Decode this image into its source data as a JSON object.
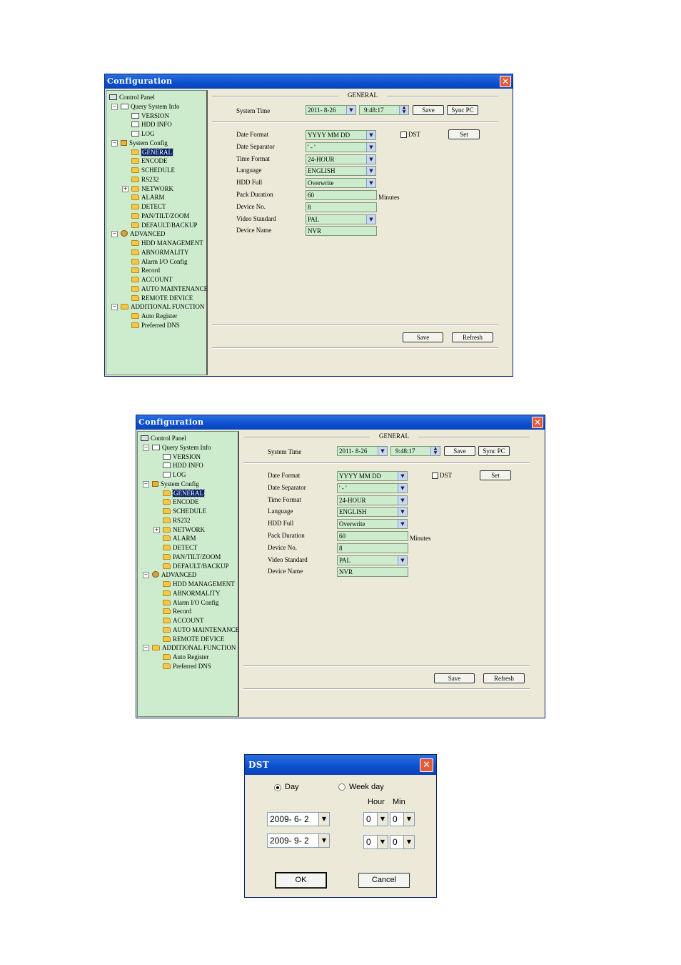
{
  "config": {
    "title": "Configuration",
    "close_glyph": "✕",
    "tree": [
      {
        "label": "Control Panel",
        "icon": "control-panel-icon"
      },
      {
        "label": "Query System Info",
        "icon": "query-info-icon",
        "expander": "−"
      },
      {
        "label": "VERSION",
        "icon": "document-icon"
      },
      {
        "label": "HDD INFO",
        "icon": "document-icon"
      },
      {
        "label": "LOG",
        "icon": "document-icon"
      },
      {
        "label": "System Config",
        "icon": "tools-icon",
        "expander": "−"
      },
      {
        "label": "GENERAL",
        "icon": "folder-open-icon",
        "selected": true
      },
      {
        "label": "ENCODE",
        "icon": "folder-icon"
      },
      {
        "label": "SCHEDULE",
        "icon": "folder-icon"
      },
      {
        "label": "RS232",
        "icon": "folder-icon"
      },
      {
        "label": "NETWORK",
        "icon": "folder-icon",
        "expander": "+"
      },
      {
        "label": "ALARM",
        "icon": "folder-icon"
      },
      {
        "label": "DETECT",
        "icon": "folder-icon"
      },
      {
        "label": "PAN/TILT/ZOOM",
        "icon": "folder-icon"
      },
      {
        "label": "DEFAULT/BACKUP",
        "icon": "folder-icon"
      },
      {
        "label": "ADVANCED",
        "icon": "advanced-icon",
        "expander": "−"
      },
      {
        "label": "HDD MANAGEMENT",
        "icon": "folder-icon"
      },
      {
        "label": "ABNORMALITY",
        "icon": "folder-icon"
      },
      {
        "label": "Alarm I/O Config",
        "icon": "folder-icon"
      },
      {
        "label": "Record",
        "icon": "folder-icon"
      },
      {
        "label": "ACCOUNT",
        "icon": "folder-icon"
      },
      {
        "label": "AUTO MAINTENANCE",
        "icon": "folder-icon"
      },
      {
        "label": "REMOTE DEVICE",
        "icon": "folder-icon"
      },
      {
        "label": "ADDITIONAL FUNCTION",
        "icon": "folder-icon",
        "expander": "−"
      },
      {
        "label": "Auto Register",
        "icon": "folder-icon"
      },
      {
        "label": "Preferred DNS",
        "icon": "folder-icon"
      }
    ],
    "general": {
      "section_title": "GENERAL",
      "system_time_label": "System Time",
      "date_value": "2011- 8-26",
      "time_value": "9:48:17",
      "save_label": "Save",
      "sync_pc_label": "Sync PC",
      "dst_label": "DST",
      "set_label": "Set",
      "minutes_label": "Minutes",
      "fields": [
        {
          "label": "Date Format",
          "value": "YYYY MM DD",
          "dropdown": true
        },
        {
          "label": "Date Separator",
          "value": "' - '",
          "dropdown": true
        },
        {
          "label": "Time Format",
          "value": "24-HOUR",
          "dropdown": true
        },
        {
          "label": "Language",
          "value": "ENGLISH",
          "dropdown": true
        },
        {
          "label": "HDD Full",
          "value": "Overwrite",
          "dropdown": true
        },
        {
          "label": "Pack Duration",
          "value": "60",
          "dropdown": false
        },
        {
          "label": "Device No.",
          "value": "8",
          "dropdown": false
        },
        {
          "label": "Video Standard",
          "value": "PAL",
          "dropdown": true
        },
        {
          "label": "Device Name",
          "value": "NVR",
          "dropdown": false
        }
      ],
      "bottom_save_label": "Save",
      "refresh_label": "Refresh"
    }
  },
  "dst_dialog": {
    "title": "DST",
    "close_glyph": "✕",
    "day_label": "Day",
    "weekday_label": "Week day",
    "hour_label": "Hour",
    "min_label": "Min",
    "start_date": "2009- 6- 2",
    "end_date": "2009- 9- 2",
    "start_hour": "0",
    "start_min": "0",
    "end_hour": "0",
    "end_min": "0",
    "ok_label": "OK",
    "cancel_label": "Cancel"
  }
}
